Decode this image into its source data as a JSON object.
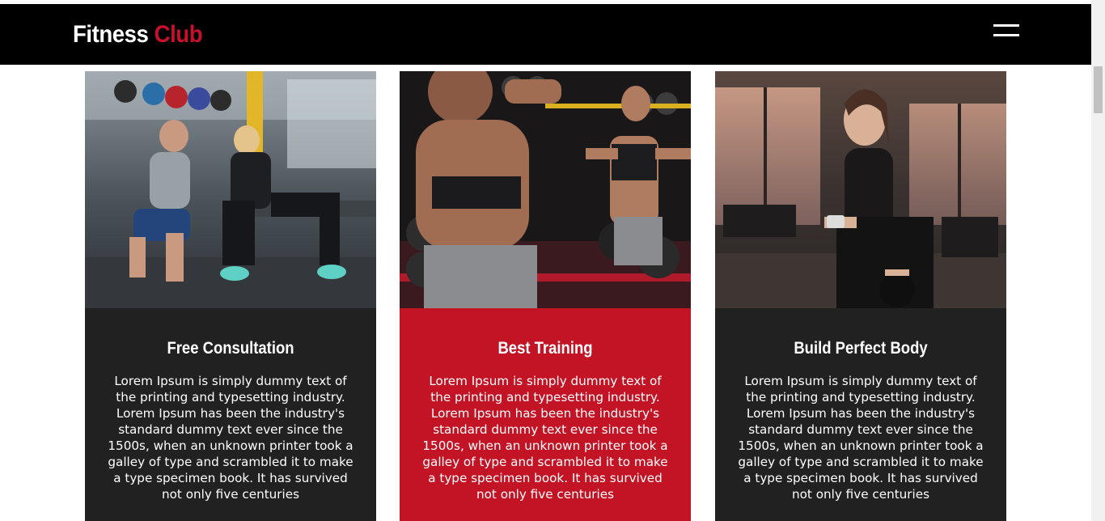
{
  "brand": {
    "part1": "Fitness",
    "part2": "Club"
  },
  "nav": {
    "menu_icon": "hamburger-menu-icon"
  },
  "colors": {
    "navbar": "#000000",
    "accent": "#c8102e",
    "card_dark": "#212121",
    "card_red": "#c31425"
  },
  "cards": [
    {
      "title": "Free Consultation",
      "text": "Lorem Ipsum is simply dummy text of the printing and typesetting industry. Lorem Ipsum has been the industry's standard dummy text ever since the 1500s, when an unknown printer took a galley of type and scrambled it to make a type specimen book. It has survived not only five centuries"
    },
    {
      "title": "Best Training",
      "text": "Lorem Ipsum is simply dummy text of the printing and typesetting industry. Lorem Ipsum has been the industry's standard dummy text ever since the 1500s, when an unknown printer took a galley of type and scrambled it to make a type specimen book. It has survived not only five centuries"
    },
    {
      "title": "Build Perfect Body",
      "text": "Lorem Ipsum is simply dummy text of the printing and typesetting industry. Lorem Ipsum has been the industry's standard dummy text ever since the 1500s, when an unknown printer took a galley of type and scrambled it to make a type specimen book. It has survived not only five centuries"
    }
  ]
}
